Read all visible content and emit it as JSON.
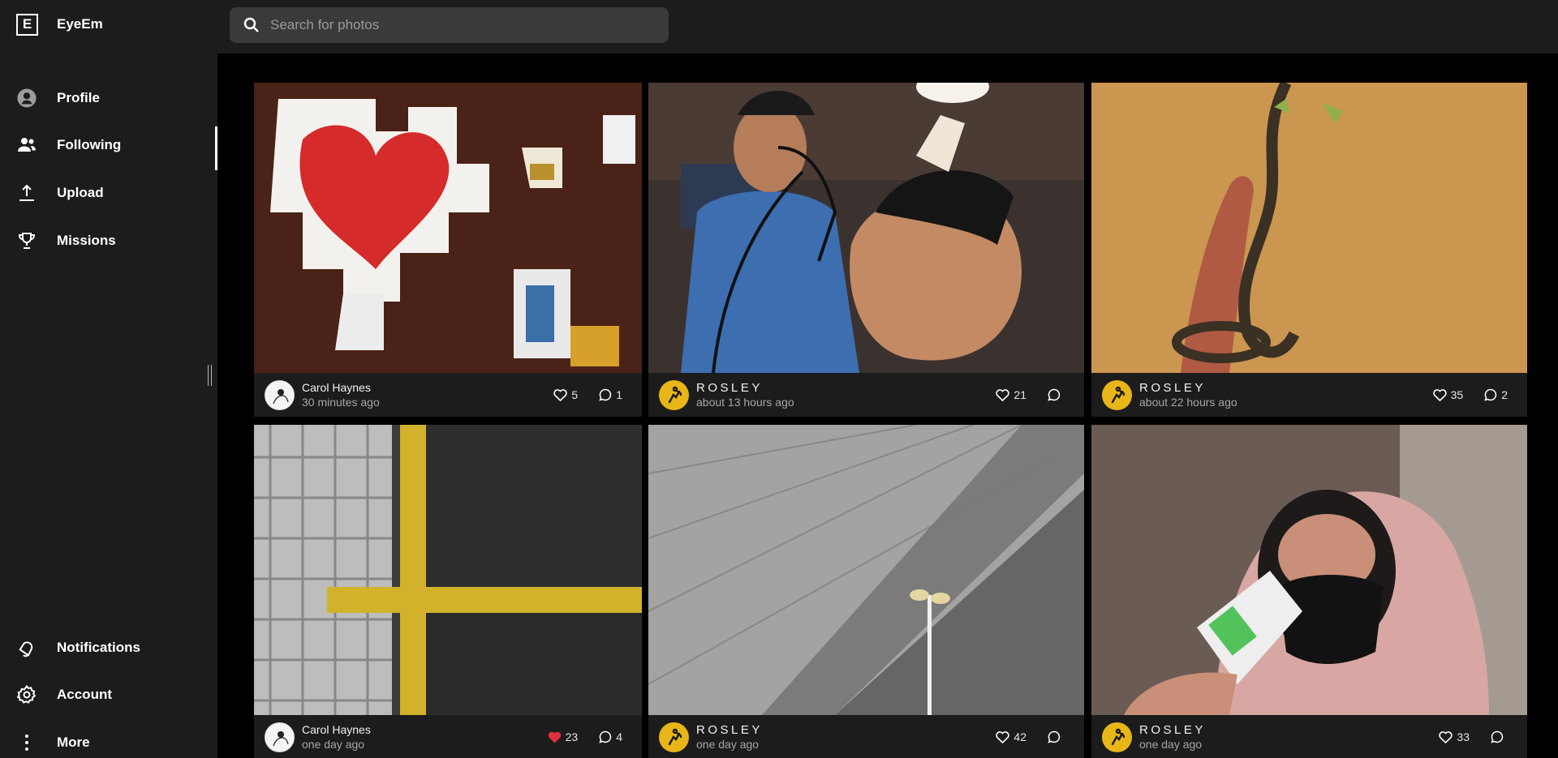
{
  "app": {
    "name": "EyeEm",
    "logo_letter": "E"
  },
  "sidebar": {
    "top_items": [
      {
        "label": "Profile",
        "icon": "avatar-icon"
      },
      {
        "label": "Following",
        "icon": "people-icon",
        "active": true
      },
      {
        "label": "Upload",
        "icon": "upload-icon"
      },
      {
        "label": "Missions",
        "icon": "trophy-icon"
      }
    ],
    "bottom_items": [
      {
        "label": "Notifications",
        "icon": "bell-icon"
      },
      {
        "label": "Account",
        "icon": "gear-icon"
      },
      {
        "label": "More",
        "icon": "more-vertical-icon"
      }
    ]
  },
  "search": {
    "placeholder": "Search for photos"
  },
  "feed": [
    {
      "user": "Carol Haynes",
      "time": "30 minutes ago",
      "likes": "5",
      "comments": "1",
      "liked": false,
      "avatar": "white",
      "photo": "puzzle-heart"
    },
    {
      "user": "ROSLEY",
      "time": "about 13 hours ago",
      "likes": "21",
      "comments": "",
      "liked": false,
      "avatar": "yellow",
      "photo": "barber"
    },
    {
      "user": "ROSLEY",
      "time": "about 22 hours ago",
      "likes": "35",
      "comments": "2",
      "liked": false,
      "avatar": "yellow",
      "photo": "vine-hand"
    },
    {
      "user": "Carol Haynes",
      "time": "one day ago",
      "likes": "23",
      "comments": "4",
      "liked": true,
      "avatar": "white",
      "photo": "road-lines"
    },
    {
      "user": "ROSLEY",
      "time": "one day ago",
      "likes": "42",
      "comments": "",
      "liked": false,
      "avatar": "yellow",
      "photo": "overpass"
    },
    {
      "user": "ROSLEY",
      "time": "one day ago",
      "likes": "33",
      "comments": "",
      "liked": false,
      "avatar": "yellow",
      "photo": "thermometer"
    }
  ],
  "colors": {
    "sidebar": "#1c1c1d",
    "background": "#000000",
    "like_active": "#e0303d",
    "avatar_yellow": "#e8b618"
  }
}
